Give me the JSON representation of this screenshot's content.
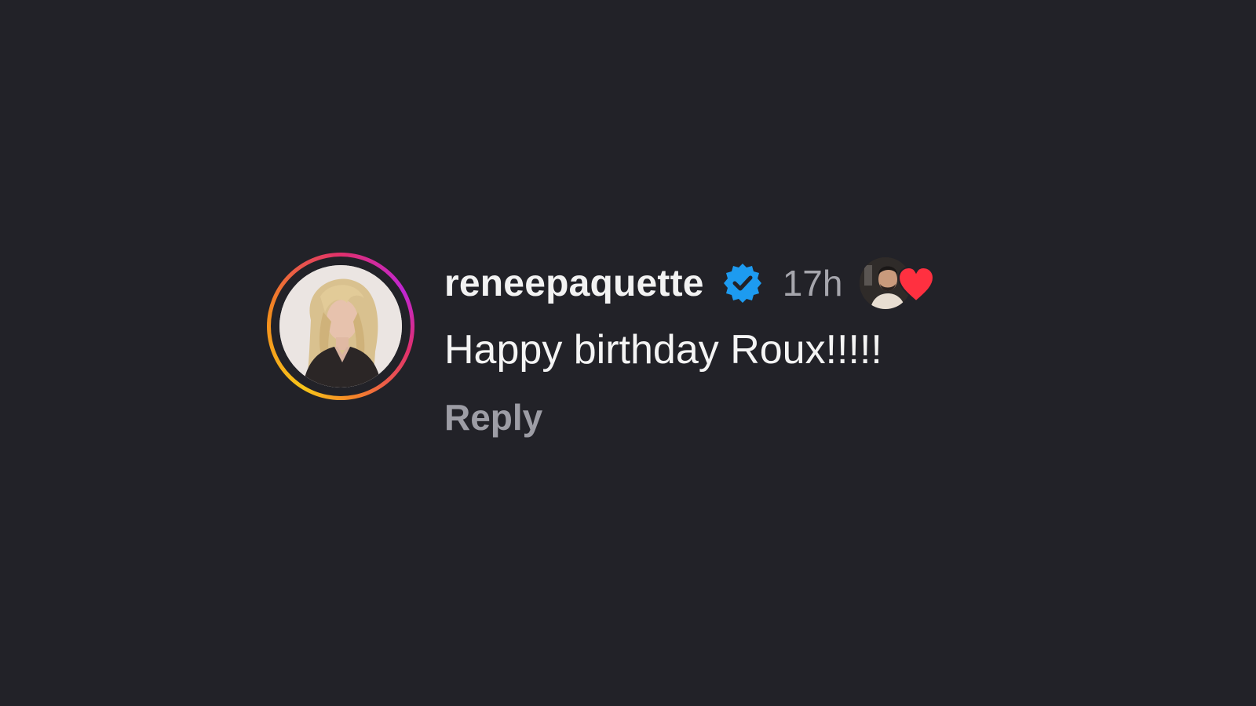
{
  "comment": {
    "username": "reneepaquette",
    "verified_icon": "verified-badge-icon",
    "timestamp": "17h",
    "text": "Happy birthday Roux!!!!!",
    "reply_label": "Reply",
    "liked_by_creator_icon": "heart-icon"
  },
  "colors": {
    "background": "#222228",
    "username": "#f2f2f2",
    "timestamp": "#a6a6ad",
    "reply": "#9d9da5",
    "verified": "#1d9bf0",
    "heart": "#ff3040"
  }
}
